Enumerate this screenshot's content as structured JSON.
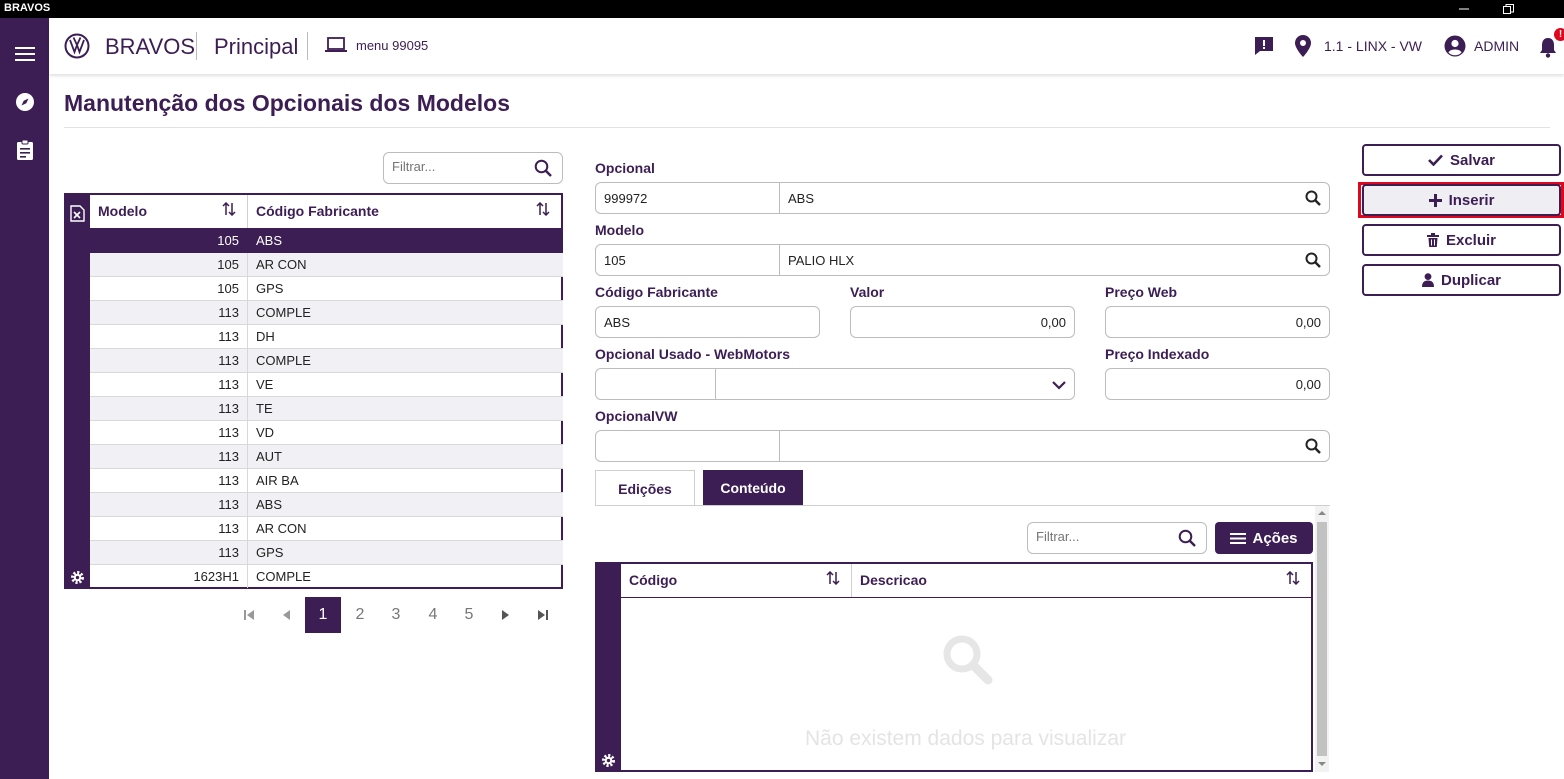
{
  "window": {
    "title": "BRAVOS"
  },
  "header": {
    "brand": "BRAVOS",
    "section": "Principal",
    "menu_code": "menu 99095",
    "location": "1.1 - LINX - VW",
    "user": "ADMIN",
    "notification_badge": "!"
  },
  "page": {
    "title": "Manutenção dos Opcionais dos Modelos"
  },
  "left_grid": {
    "filter_placeholder": "Filtrar...",
    "columns": [
      "Modelo",
      "Código Fabricante"
    ],
    "rows": [
      [
        "105",
        "ABS"
      ],
      [
        "105",
        "AR CON"
      ],
      [
        "105",
        "GPS"
      ],
      [
        "113",
        "COMPLE"
      ],
      [
        "113",
        "DH"
      ],
      [
        "113",
        "COMPLE"
      ],
      [
        "113",
        "VE"
      ],
      [
        "113",
        "TE"
      ],
      [
        "113",
        "VD"
      ],
      [
        "113",
        "AUT"
      ],
      [
        "113",
        "AIR BA"
      ],
      [
        "113",
        "ABS"
      ],
      [
        "113",
        "AR CON"
      ],
      [
        "113",
        "GPS"
      ],
      [
        "1623H1",
        "COMPLE"
      ]
    ],
    "selected_row": 0,
    "pages": [
      "1",
      "2",
      "3",
      "4",
      "5"
    ],
    "current_page": "1"
  },
  "form": {
    "opcional": {
      "label": "Opcional",
      "code": "999972",
      "desc": "ABS"
    },
    "modelo": {
      "label": "Modelo",
      "code": "105",
      "desc": "PALIO HLX"
    },
    "codigo_fabricante": {
      "label": "Código Fabricante",
      "value": "ABS"
    },
    "valor": {
      "label": "Valor",
      "value": "0,00"
    },
    "preco_web": {
      "label": "Preço Web",
      "value": "0,00"
    },
    "opcional_usado": {
      "label": "Opcional Usado - WebMotors",
      "code": "",
      "desc": ""
    },
    "preco_indexado": {
      "label": "Preço Indexado",
      "value": "0,00"
    },
    "opcional_vw": {
      "label": "OpcionalVW",
      "code": "",
      "desc": ""
    }
  },
  "tabs": [
    {
      "label": "Edições",
      "active": false
    },
    {
      "label": "Conteúdo",
      "active": true
    }
  ],
  "content_grid": {
    "filter_placeholder": "Filtrar...",
    "actions_label": "Ações",
    "columns": [
      "Código",
      "Descricao"
    ],
    "empty_message": "Não existem dados para visualizar"
  },
  "actions": {
    "save": "Salvar",
    "insert": "Inserir",
    "delete": "Excluir",
    "duplicate": "Duplicar"
  },
  "colors": {
    "primary": "#3c1e54",
    "highlight": "#e0061d"
  }
}
